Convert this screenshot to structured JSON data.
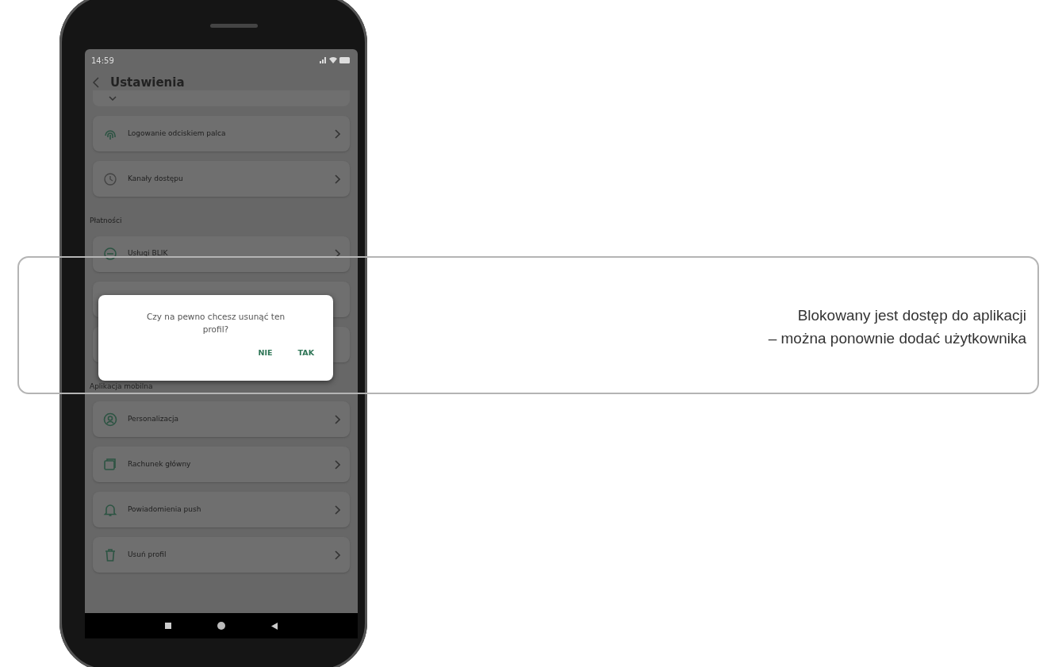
{
  "status_bar": {
    "time": "14:59"
  },
  "header": {
    "title": "Ustawienia"
  },
  "rows": [
    {
      "kind": "partial"
    },
    {
      "kind": "card",
      "label": "Logowanie odciskiem palca"
    },
    {
      "kind": "card",
      "label": "Kanały dostępu"
    },
    {
      "kind": "section",
      "label": "Płatności"
    },
    {
      "kind": "card",
      "label": "Usługi BLIK"
    },
    {
      "kind": "blank"
    },
    {
      "kind": "blank"
    },
    {
      "kind": "section",
      "label": "Aplikacja mobilna"
    },
    {
      "kind": "card",
      "label": "Personalizacja"
    },
    {
      "kind": "card",
      "label": "Rachunek główny"
    },
    {
      "kind": "card",
      "label": "Powiadomienia push"
    },
    {
      "kind": "card",
      "label": "Usuń profil"
    }
  ],
  "dialog": {
    "message": "Czy na pewno chcesz usunąć ten profil?",
    "buttons": [
      "NIE",
      "TAK"
    ]
  },
  "caption": [
    "Blokowany jest dostęp do aplikacji",
    "– można ponownie dodać użytkownika"
  ]
}
